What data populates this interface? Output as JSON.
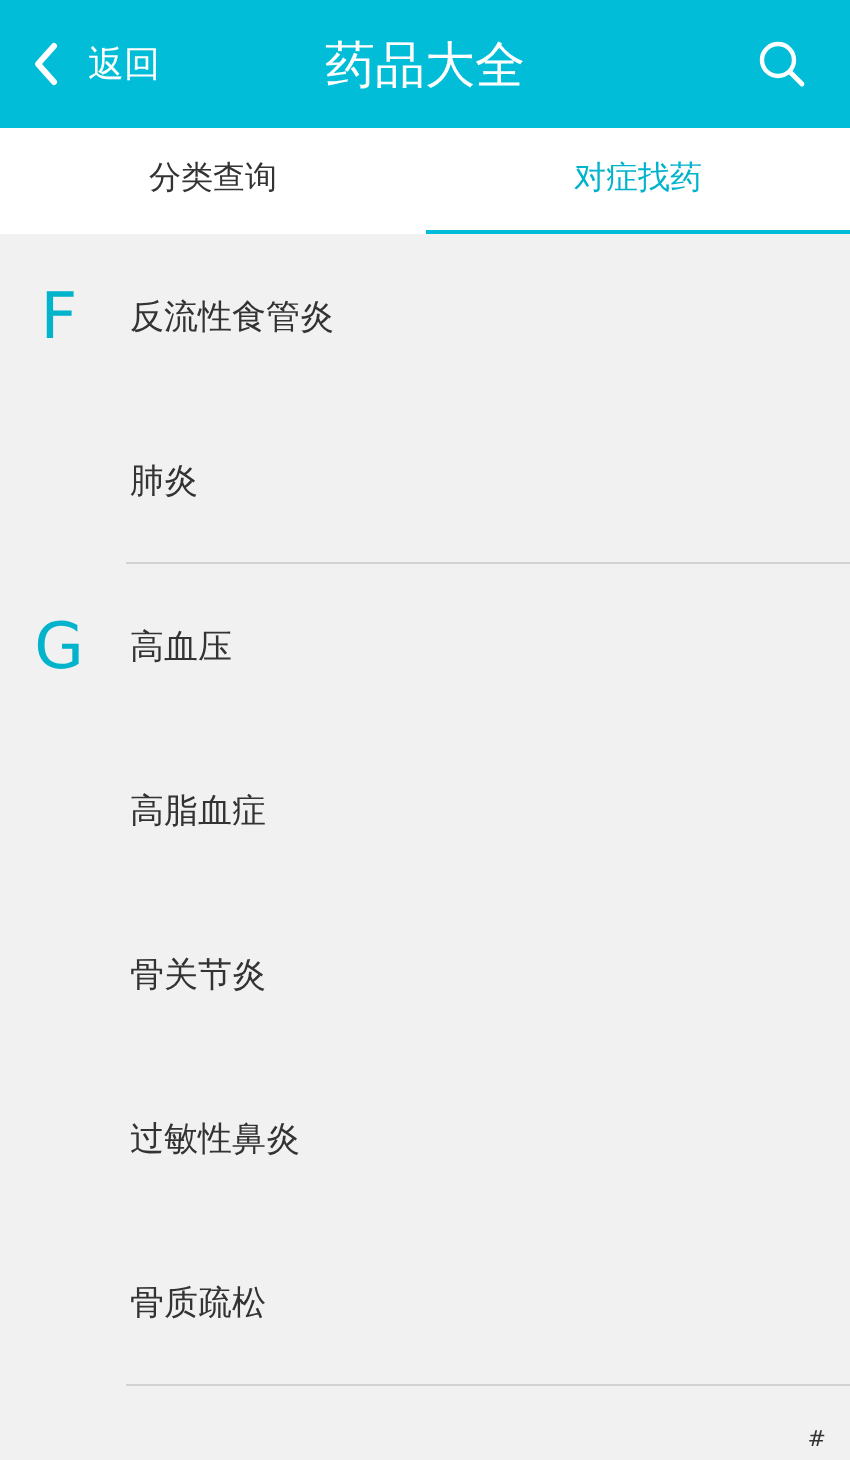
{
  "header": {
    "back_label": "返回",
    "title": "药品大全"
  },
  "tabs": [
    {
      "label": "分类查询",
      "selected": false
    },
    {
      "label": "对症找药",
      "selected": true
    }
  ],
  "groups": [
    {
      "letter": "F",
      "items": [
        "反流性食管炎",
        "肺炎"
      ]
    },
    {
      "letter": "G",
      "items": [
        "高血压",
        "高脂血症",
        "骨关节炎",
        "过敏性鼻炎",
        "骨质疏松"
      ]
    }
  ],
  "index": [
    "#"
  ]
}
